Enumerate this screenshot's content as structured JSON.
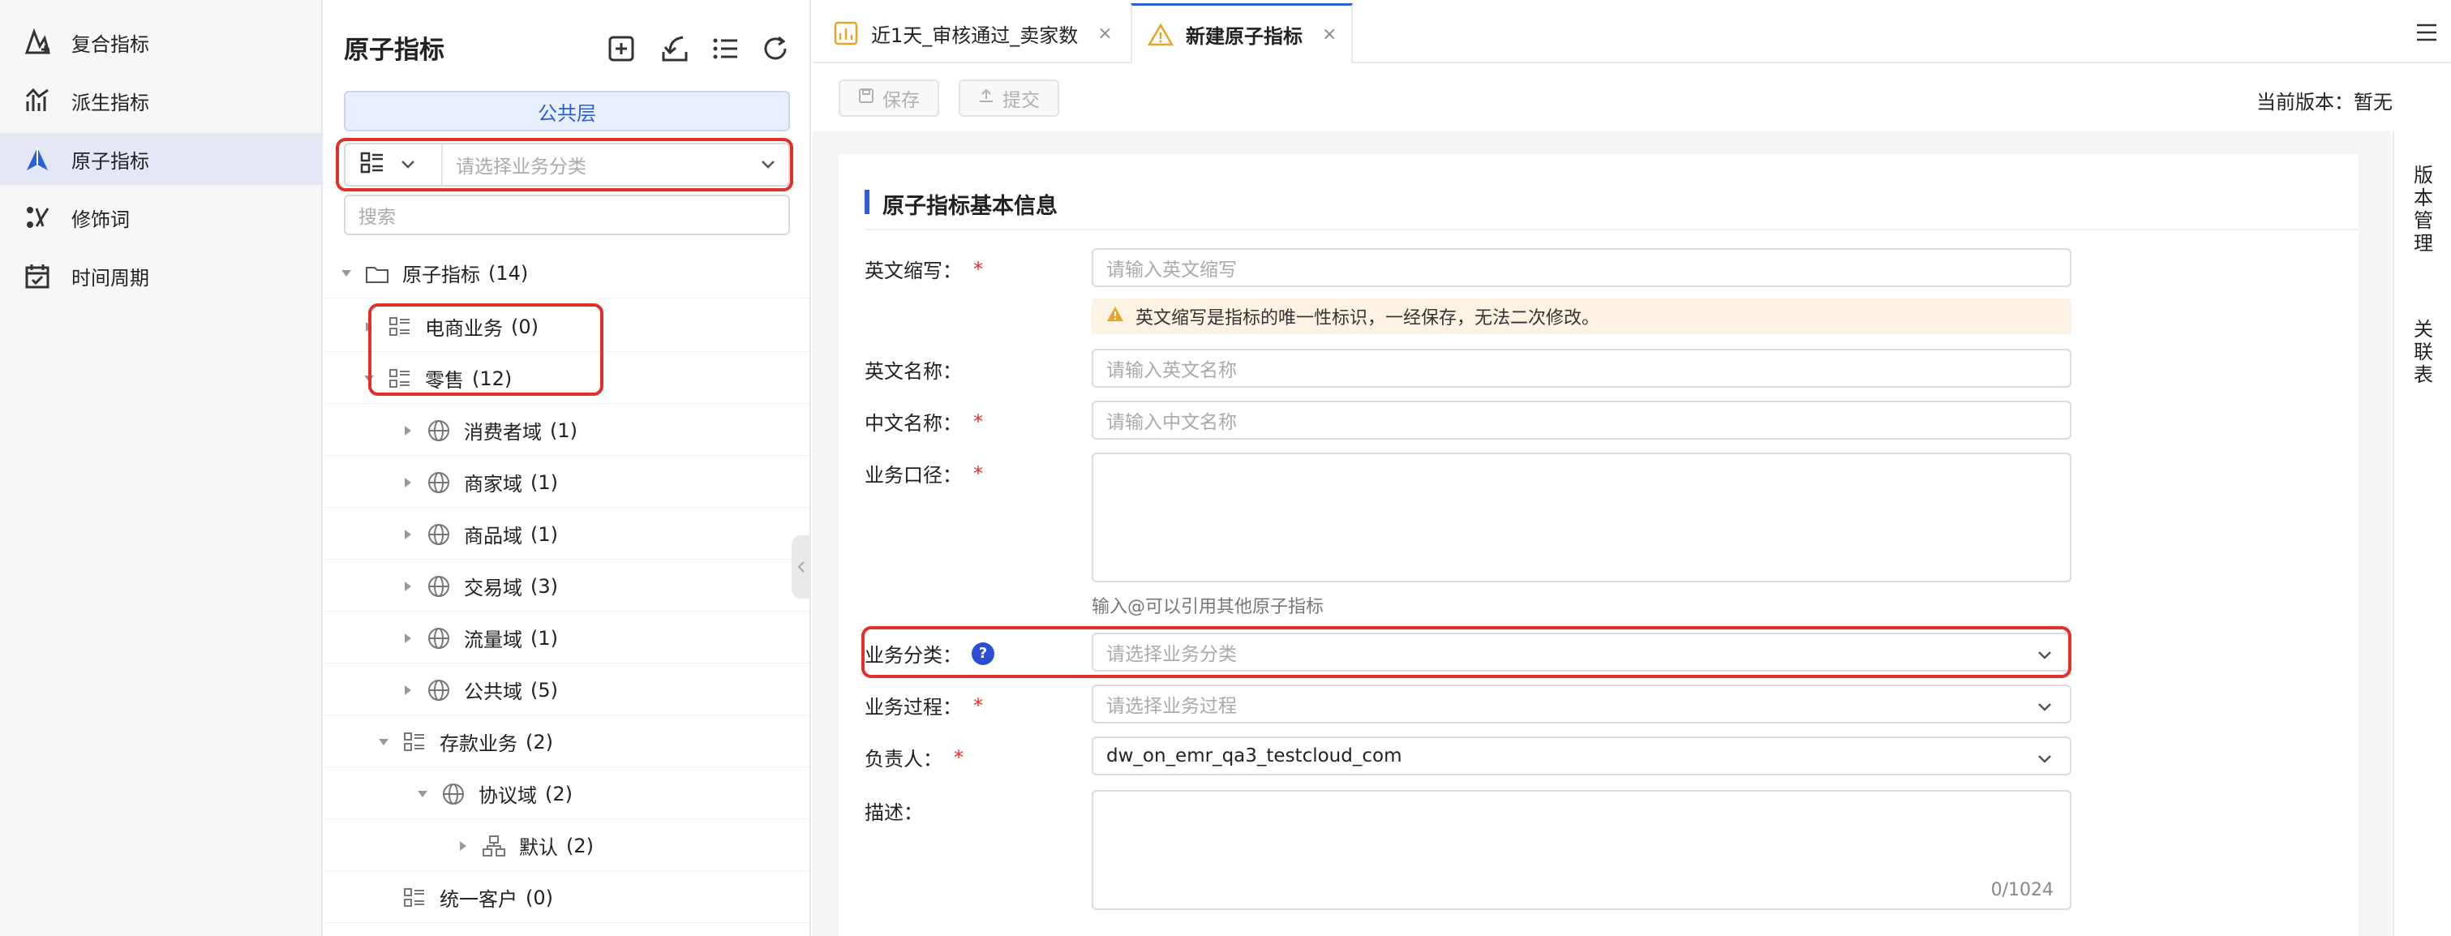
{
  "nav": {
    "items": [
      {
        "label": "复合指标",
        "icon": "composite-metric-icon"
      },
      {
        "label": "派生指标",
        "icon": "derived-metric-icon"
      },
      {
        "label": "原子指标",
        "icon": "atomic-metric-icon",
        "active": true
      },
      {
        "label": "修饰词",
        "icon": "modifier-icon"
      },
      {
        "label": "时间周期",
        "icon": "calendar-icon"
      }
    ]
  },
  "panel": {
    "title": "原子指标",
    "layer_tab": "公共层",
    "category_placeholder": "请选择业务分类",
    "search_placeholder": "搜索",
    "tree": [
      {
        "label": "原子指标",
        "count": "(14)"
      },
      {
        "label": "电商业务",
        "count": "(0)"
      },
      {
        "label": "零售",
        "count": "(12)"
      },
      {
        "label": "消费者域",
        "count": "(1)"
      },
      {
        "label": "商家域",
        "count": "(1)"
      },
      {
        "label": "商品域",
        "count": "(1)"
      },
      {
        "label": "交易域",
        "count": "(3)"
      },
      {
        "label": "流量域",
        "count": "(1)"
      },
      {
        "label": "公共域",
        "count": "(5)"
      },
      {
        "label": "存款业务",
        "count": "(2)"
      },
      {
        "label": "协议域",
        "count": "(2)"
      },
      {
        "label": "默认",
        "count": "(2)"
      },
      {
        "label": "统一客户",
        "count": "(0)"
      }
    ]
  },
  "tabs": [
    {
      "label": "近1天_审核通过_卖家数",
      "close": "×"
    },
    {
      "label": "新建原子指标",
      "close": "×"
    }
  ],
  "toolbar": {
    "save_label": "保存",
    "submit_label": "提交",
    "version_label": "当前版本：",
    "version_value": "暂无"
  },
  "form": {
    "section_title": "原子指标基本信息",
    "req_mark": "*",
    "en_abbr_label": "英文缩写：",
    "en_abbr_placeholder": "请输入英文缩写",
    "en_abbr_warning": "英文缩写是指标的唯一性标识，一经保存，无法二次修改。",
    "en_name_label": "英文名称：",
    "en_name_placeholder": "请输入英文名称",
    "cn_name_label": "中文名称：",
    "cn_name_placeholder": "请输入中文名称",
    "caliber_label": "业务口径：",
    "caliber_hint": "输入@可以引用其他原子指标",
    "category_label": "业务分类：",
    "category_help": "?",
    "category_placeholder": "请选择业务分类",
    "process_label": "业务过程：",
    "process_placeholder": "请选择业务过程",
    "owner_label": "负责人：",
    "owner_value": "dw_on_emr_qa3_testcloud_com",
    "desc_label": "描述：",
    "desc_counter": "0/1024"
  },
  "right_sidebar": {
    "version_mgmt": "版本管理",
    "related_tables": "关联表"
  },
  "colors": {
    "accent": "#2a5fd6",
    "highlight": "#e0302a",
    "warning_bg": "#fdf3e4",
    "nav_active_bg": "#e4e8f5"
  }
}
